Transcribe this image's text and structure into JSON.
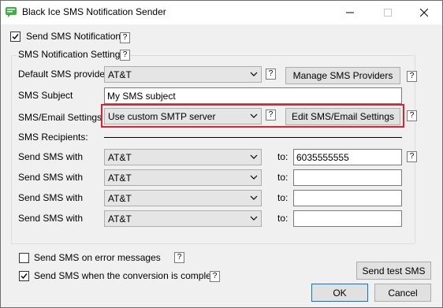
{
  "window": {
    "title": "Black Ice SMS Notification Sender"
  },
  "send_sms": {
    "label": "Send SMS Notification",
    "checked": true
  },
  "settings": {
    "group_label": "SMS Notification Settings",
    "default_provider_label": "Default SMS provider",
    "default_provider_value": "AT&T",
    "manage_button": "Manage SMS Providers",
    "subject_label": "SMS Subject",
    "subject_value": "My SMS subject",
    "email_settings_label": "SMS/Email Settings",
    "email_settings_value": "Use custom SMTP server",
    "edit_button": "Edit SMS/Email Settings",
    "recipients_label": "SMS Recipients:",
    "recipients": [
      {
        "label": "Send SMS with",
        "provider": "AT&T",
        "to_label": "to:",
        "number": "6035555555"
      },
      {
        "label": "Send SMS with",
        "provider": "AT&T",
        "to_label": "to:",
        "number": ""
      },
      {
        "label": "Send SMS with",
        "provider": "AT&T",
        "to_label": "to:",
        "number": ""
      },
      {
        "label": "Send SMS with",
        "provider": "AT&T",
        "to_label": "to:",
        "number": ""
      }
    ]
  },
  "options": {
    "on_error_label": "Send SMS on error messages",
    "on_error_checked": false,
    "on_complete_label": "Send SMS when the conversion is complete",
    "on_complete_checked": true
  },
  "help_glyph": "?",
  "buttons": {
    "send_test": "Send test SMS",
    "ok": "OK",
    "cancel": "Cancel"
  },
  "colors": {
    "highlight": "#e0202c",
    "app_icon": "#3cb043"
  }
}
